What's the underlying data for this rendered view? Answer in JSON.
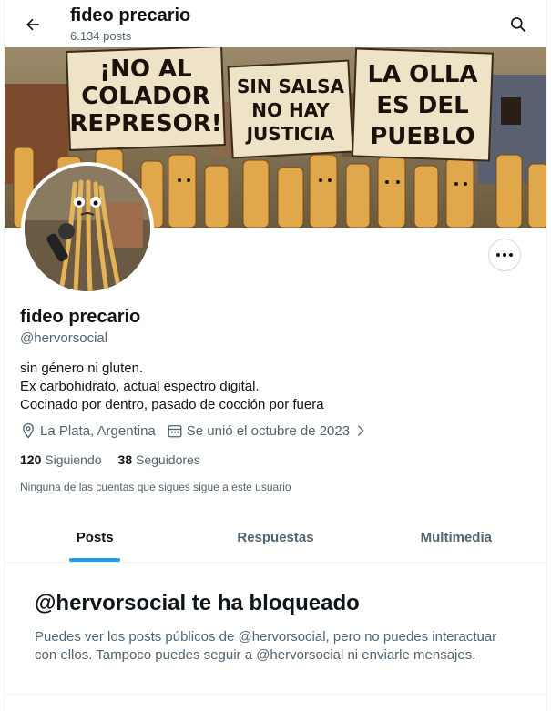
{
  "header": {
    "title": "fideo precario",
    "subtitle": "6.134 posts"
  },
  "banner": {
    "signs": [
      [
        "¡NO AL",
        "COLADOR",
        "REPRESOR!"
      ],
      [
        "SIN SALSA",
        "NO HAY",
        "JUSTICIA"
      ],
      [
        "LA OLLA",
        "ES DEL",
        "PUEBLO"
      ]
    ]
  },
  "profile": {
    "name": "fideo precario",
    "handle": "@hervorsocial",
    "bio": [
      "sin género ni gluten.",
      "Ex carbohidrato, actual espectro digital.",
      "Cocinado por dentro, pasado de cocción por fuera"
    ],
    "location": "La Plata, Argentina",
    "joined": "Se unió el octubre de 2023",
    "following_count": "120",
    "following_label": "Siguiendo",
    "followers_count": "38",
    "followers_label": "Seguidores",
    "followers_note": "Ninguna de las cuentas que sigues sigue a este usuario"
  },
  "tabs": [
    {
      "label": "Posts",
      "active": true
    },
    {
      "label": "Respuestas",
      "active": false
    },
    {
      "label": "Multimedia",
      "active": false
    }
  ],
  "blocked": {
    "title": "@hervorsocial te ha bloqueado",
    "message": "Puedes ver los posts públicos de @hervorsocial, pero no puedes interactuar con ellos. Tampoco puedes seguir a @hervorsocial ni enviarle mensajes."
  },
  "colors": {
    "accent": "#1d9bf0",
    "muted": "#536471",
    "text": "#0f1419"
  },
  "icons": [
    "back-arrow-icon",
    "search-icon",
    "more-icon",
    "location-icon",
    "calendar-icon",
    "chevron-right-icon"
  ]
}
